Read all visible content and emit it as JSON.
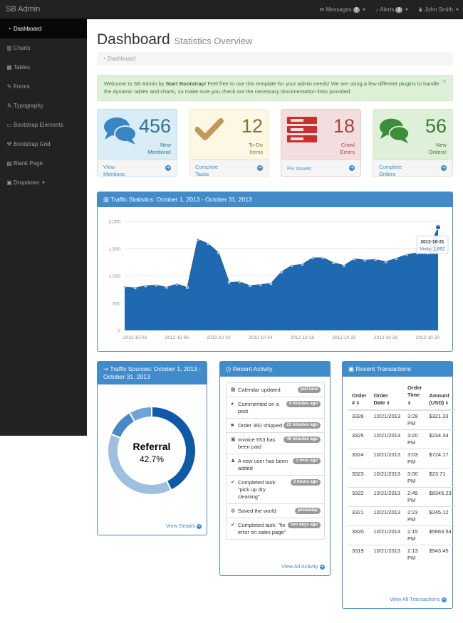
{
  "navbar": {
    "brand": "SB Admin",
    "messages_label": "Messages",
    "messages_count": "7",
    "alerts_label": "Alerts",
    "alerts_count": "3",
    "user_name": "John Smith"
  },
  "sidebar": {
    "items": [
      {
        "label": "Dashboard",
        "icon": "dashboard-icon"
      },
      {
        "label": "Charts",
        "icon": "bar-chart-icon"
      },
      {
        "label": "Tables",
        "icon": "table-icon"
      },
      {
        "label": "Forms",
        "icon": "edit-icon"
      },
      {
        "label": "Typography",
        "icon": "font-icon"
      },
      {
        "label": "Bootstrap Elements",
        "icon": "desktop-icon"
      },
      {
        "label": "Bootstrap Grid",
        "icon": "wrench-icon"
      },
      {
        "label": "Blank Page",
        "icon": "file-icon"
      },
      {
        "label": "Dropdown",
        "icon": "caret-square-icon"
      }
    ]
  },
  "page": {
    "title": "Dashboard",
    "subtitle": "Statistics Overview",
    "breadcrumb": "Dashboard"
  },
  "alert": {
    "prefix": "Welcome to SB Admin by ",
    "bold": "Start Bootstrap",
    "text": "! Feel free to use this template for your admin needs! We are using a few different plugins to handle the dynamic tables and charts, so make sure you check out the necessary documentation links provided.",
    "close": "×"
  },
  "stats": [
    {
      "value": "456",
      "label_line1": "New",
      "label_line2": "Mentions!",
      "link_line1": "View",
      "link_line2": "Mentions",
      "icon": "comments-icon",
      "color": "#3a86c5"
    },
    {
      "value": "12",
      "label_line1": "To-Do",
      "label_line2": "Items",
      "link_line1": "Complete",
      "link_line2": "Tasks",
      "icon": "check-icon",
      "color": "#c19a5b"
    },
    {
      "value": "18",
      "label_line1": "Crawl",
      "label_line2": "Errors",
      "link_line1": "Fix Issues",
      "link_line2": "",
      "icon": "server-icon",
      "color": "#c9302c"
    },
    {
      "value": "56",
      "label_line1": "New",
      "label_line2": "Orders!",
      "link_line1": "Complete",
      "link_line2": "Orders",
      "icon": "comments-icon",
      "color": "#3c8d3c"
    }
  ],
  "traffic_panel": {
    "title": "Traffic Statistics: October 1, 2013 - October 31, 2013",
    "tooltip_date": "2012-10-31",
    "tooltip_visits": "Visits: 1,892"
  },
  "chart_data": [
    {
      "type": "area",
      "x": [
        "2012-10-01",
        "2012-10-02",
        "2012-10-03",
        "2012-10-04",
        "2012-10-05",
        "2012-10-06",
        "2012-10-07",
        "2012-10-08",
        "2012-10-09",
        "2012-10-10",
        "2012-10-11",
        "2012-10-12",
        "2012-10-13",
        "2012-10-14",
        "2012-10-15",
        "2012-10-16",
        "2012-10-17",
        "2012-10-18",
        "2012-10-19",
        "2012-10-20",
        "2012-10-21",
        "2012-10-22",
        "2012-10-23",
        "2012-10-24",
        "2012-10-25",
        "2012-10-26",
        "2012-10-27",
        "2012-10-28",
        "2012-10-29",
        "2012-10-30",
        "2012-10-31"
      ],
      "series": [
        {
          "values": [
            795,
            780,
            815,
            830,
            790,
            850,
            785,
            1670,
            1590,
            1420,
            880,
            890,
            820,
            840,
            860,
            1070,
            1190,
            1210,
            1330,
            1330,
            1240,
            1190,
            1310,
            1290,
            1300,
            1260,
            1320,
            1390,
            1420,
            1420,
            1892
          ]
        }
      ],
      "xticks": [
        "2012-10-02",
        "2012-10-06",
        "2012-10-10",
        "2012-10-14",
        "2012-10-18",
        "2012-10-22",
        "2012-10-26",
        "2012-10-30"
      ],
      "yticks": [
        "0",
        "500",
        "1,000",
        "1,500",
        "2,000"
      ],
      "ylim": [
        0,
        2000
      ],
      "grid": true,
      "color": "#1f69b0"
    },
    {
      "type": "pie",
      "title": "Traffic Sources: October 1, 2013 - October 31, 2013",
      "center_label": "Referral",
      "center_value": "42.7%",
      "values": [
        42.7,
        38.5,
        10.4,
        8.4
      ],
      "colors": [
        "#0e5aa8",
        "#9ec0e0",
        "#4a87c4",
        "#6ea5d7"
      ]
    }
  ],
  "sources_panel": {
    "link": "View Details"
  },
  "activity": {
    "title": "Recent Activity",
    "items": [
      {
        "text": "Calendar updated",
        "badge": "just now",
        "icon": "calendar-icon",
        "glyph": "▦"
      },
      {
        "text": "Commented on a post",
        "badge": "4 minutes ago",
        "icon": "comment-icon",
        "glyph": "●"
      },
      {
        "text": "Order 392 shipped",
        "badge": "23 minutes ago",
        "icon": "truck-icon",
        "glyph": "■"
      },
      {
        "text": "Invoice 653 has been paid",
        "badge": "46 minutes ago",
        "icon": "money-icon",
        "glyph": "▣"
      },
      {
        "text": "A new user has been added",
        "badge": "1 hour ago",
        "icon": "user-icon",
        "glyph": "♟"
      },
      {
        "text": "Completed task: \"pick up dry cleaning\"",
        "badge": "2 hours ago",
        "icon": "check-icon",
        "glyph": "✔"
      },
      {
        "text": "Saved the world",
        "badge": "yesterday",
        "icon": "globe-icon",
        "glyph": "◍"
      },
      {
        "text": "Completed task: \"fix error on sales page\"",
        "badge": "two days ago",
        "icon": "check-icon",
        "glyph": "✔"
      }
    ],
    "link": "View All Activity"
  },
  "transactions": {
    "title": "Recent Transactions",
    "headers": [
      "Order #",
      "Order Date",
      "Order Time",
      "Amount (USD)"
    ],
    "rows": [
      [
        "3326",
        "10/21/2013",
        "3:29 PM",
        "$321.33"
      ],
      [
        "3325",
        "10/21/2013",
        "3:20 PM",
        "$234.34"
      ],
      [
        "3324",
        "10/21/2013",
        "3:03 PM",
        "$724.17"
      ],
      [
        "3323",
        "10/21/2013",
        "3:00 PM",
        "$23.71"
      ],
      [
        "3322",
        "10/21/2013",
        "2:49 PM",
        "$8345.23"
      ],
      [
        "3321",
        "10/21/2013",
        "2:23 PM",
        "$245.12"
      ],
      [
        "3320",
        "10/21/2013",
        "2:15 PM",
        "$5663.54"
      ],
      [
        "3319",
        "10/21/2013",
        "2:13 PM",
        "$943.45"
      ]
    ],
    "link": "View All Transactions"
  }
}
